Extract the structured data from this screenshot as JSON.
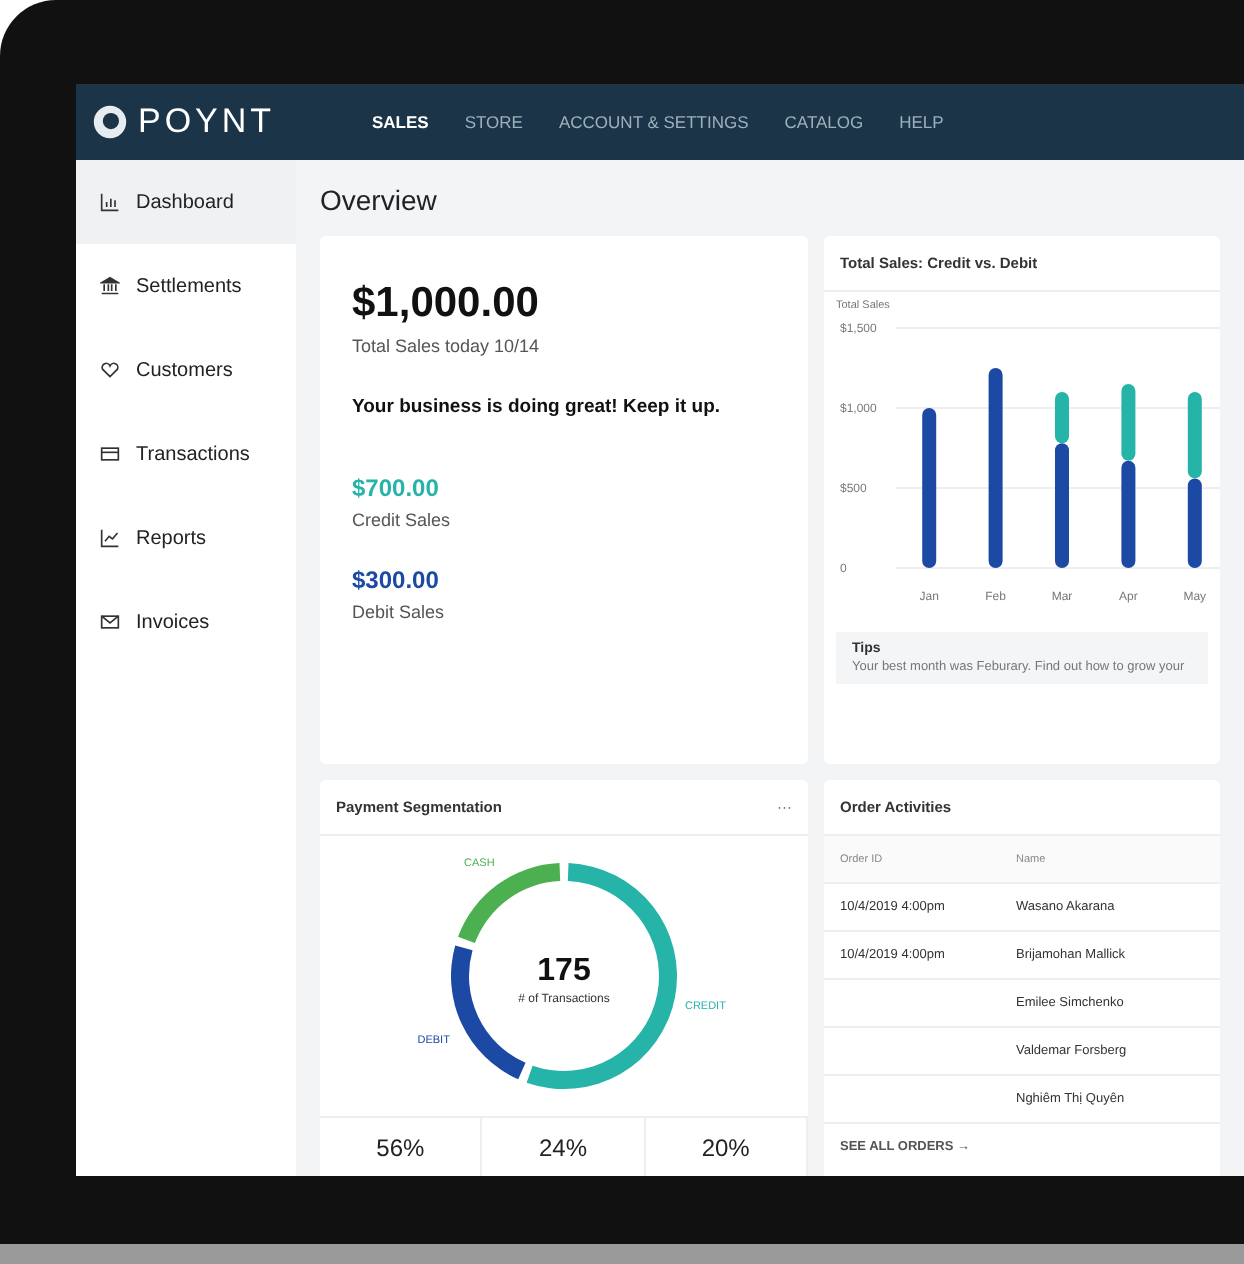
{
  "brand": {
    "name": "POYNT"
  },
  "nav": [
    {
      "label": "SALES",
      "selected": true
    },
    {
      "label": "STORE",
      "selected": false
    },
    {
      "label": "ACCOUNT & SETTINGS",
      "selected": false
    },
    {
      "label": "CATALOG",
      "selected": false
    },
    {
      "label": "HELP",
      "selected": false
    }
  ],
  "sidebar": {
    "items": [
      {
        "label": "Dashboard",
        "selected": true
      },
      {
        "label": "Settlements",
        "selected": false
      },
      {
        "label": "Customers",
        "selected": false
      },
      {
        "label": "Transactions",
        "selected": false
      },
      {
        "label": "Reports",
        "selected": false
      },
      {
        "label": "Invoices",
        "selected": false
      }
    ]
  },
  "page": {
    "title": "Overview"
  },
  "summary": {
    "total": "$1,000.00",
    "total_label": "Total Sales today 10/14",
    "message": "Your business is doing great! Keep it up.",
    "items": [
      {
        "amount": "$700.00",
        "label": "Credit Sales",
        "color": "#26b3a8"
      },
      {
        "amount": "$300.00",
        "label": "Debit Sales",
        "color": "#1b49a3"
      }
    ]
  },
  "sales_chart": {
    "title": "Total Sales:  Credit vs. Debit",
    "chart_data": {
      "type": "bar",
      "stacked": true,
      "ylabel": "Total Sales",
      "categories": [
        "Jan",
        "Feb",
        "Mar",
        "Apr",
        "May"
      ],
      "series": [
        {
          "color": "#1b49a3",
          "values": [
            1000,
            1250,
            780,
            670,
            560
          ]
        },
        {
          "color": "#26b3a8",
          "values": [
            0,
            0,
            320,
            480,
            540
          ]
        }
      ],
      "ylim": [
        0,
        1500
      ],
      "yticks": [
        {
          "value": 0,
          "label": "0"
        },
        {
          "value": 500,
          "label": "$500"
        },
        {
          "value": 1000,
          "label": "$1,000"
        },
        {
          "value": 1500,
          "label": "$1,500"
        }
      ]
    },
    "tips": {
      "title": "Tips",
      "text": "Your best month was Feburary. Find out how to grow your"
    }
  },
  "segmentation": {
    "title": "Payment Segmentation",
    "menu": "···",
    "center_value": "175",
    "center_label": "# of Transactions",
    "chart_data": {
      "type": "donut",
      "categories": [
        "CREDIT",
        "DEBIT",
        "CASH"
      ],
      "series": [
        {
          "values": [
            56,
            24,
            20
          ]
        }
      ],
      "colors": [
        "#26b3a8",
        "#1b49a3",
        "#4caf50"
      ]
    },
    "stats": [
      "56%",
      "24%",
      "20%"
    ]
  },
  "orders": {
    "title": "Order Activities",
    "columns": [
      "Order ID",
      "Name"
    ],
    "rows": [
      [
        "10/4/2019 4:00pm",
        "Wasano Akarana"
      ],
      [
        "10/4/2019 4:00pm",
        "Brijamohan Mallick"
      ],
      [
        "",
        "Emilee Simchenko"
      ],
      [
        "",
        "Valdemar Forsberg"
      ],
      [
        "",
        "Nghiêm Thị Quyên"
      ]
    ],
    "link": "SEE ALL ORDERS →"
  }
}
